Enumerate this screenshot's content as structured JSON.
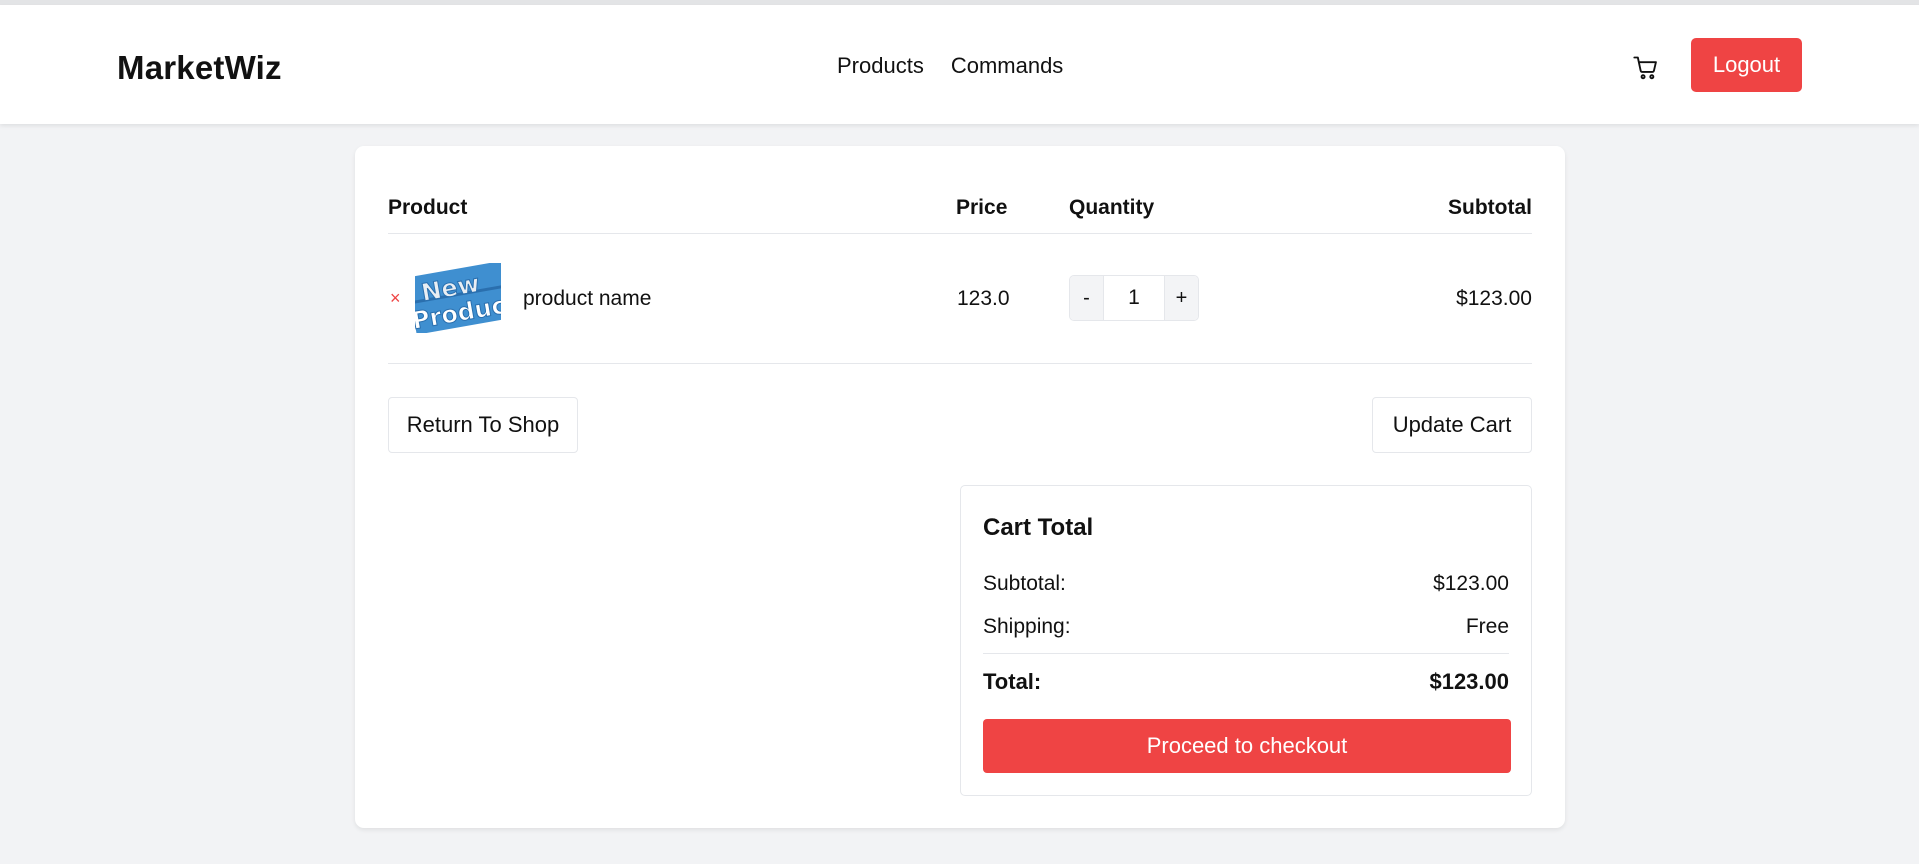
{
  "brand": "MarketWiz",
  "nav": [
    "Products",
    "Commands"
  ],
  "header": {
    "cart_icon": "cart-icon",
    "logout_label": "Logout"
  },
  "table": {
    "headers": {
      "product": "Product",
      "price": "Price",
      "quantity": "Quantity",
      "subtotal": "Subtotal"
    },
    "rows": [
      {
        "remove_symbol": "×",
        "image_text": "New Product",
        "name": "product name",
        "price": "123.0",
        "qty_minus": "-",
        "quantity": "1",
        "qty_plus": "+",
        "subtotal": "$123.00"
      }
    ]
  },
  "actions": {
    "return_label": "Return To Shop",
    "update_label": "Update Cart"
  },
  "cart_total": {
    "title": "Cart Total",
    "subtotal_label": "Subtotal:",
    "subtotal_value": "$123.00",
    "shipping_label": "Shipping:",
    "shipping_value": "Free",
    "total_label": "Total:",
    "total_value": "$123.00",
    "checkout_label": "Proceed to checkout"
  },
  "colors": {
    "accent": "#ef4444",
    "background": "#f2f3f5",
    "card": "#ffffff",
    "border": "#e5e7eb"
  }
}
